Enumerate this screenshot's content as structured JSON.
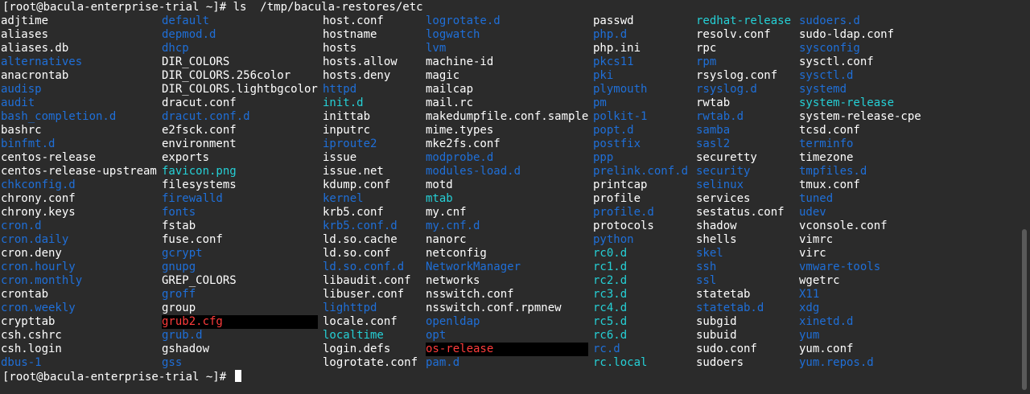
{
  "terminal": {
    "command_line": "[root@bacula-enterprise-trial ~]# ls  /tmp/bacula-restores/etc",
    "prompt": "[root@bacula-enterprise-trial ~]# ",
    "colors": {
      "background": "#2b2b2b",
      "file": "#ffffff",
      "dir": "#1f6fd8",
      "link": "#25d0d6",
      "broken": "#ff3b3b"
    },
    "columns": [
      [
        {
          "name": "adjtime",
          "kind": "file"
        },
        {
          "name": "aliases",
          "kind": "file"
        },
        {
          "name": "aliases.db",
          "kind": "file"
        },
        {
          "name": "alternatives",
          "kind": "dir"
        },
        {
          "name": "anacrontab",
          "kind": "file"
        },
        {
          "name": "audisp",
          "kind": "dir"
        },
        {
          "name": "audit",
          "kind": "dir"
        },
        {
          "name": "bash_completion.d",
          "kind": "dir"
        },
        {
          "name": "bashrc",
          "kind": "file"
        },
        {
          "name": "binfmt.d",
          "kind": "dir"
        },
        {
          "name": "centos-release",
          "kind": "file"
        },
        {
          "name": "centos-release-upstream",
          "kind": "file"
        },
        {
          "name": "chkconfig.d",
          "kind": "dir"
        },
        {
          "name": "chrony.conf",
          "kind": "file"
        },
        {
          "name": "chrony.keys",
          "kind": "file"
        },
        {
          "name": "cron.d",
          "kind": "dir"
        },
        {
          "name": "cron.daily",
          "kind": "dir"
        },
        {
          "name": "cron.deny",
          "kind": "file"
        },
        {
          "name": "cron.hourly",
          "kind": "dir"
        },
        {
          "name": "cron.monthly",
          "kind": "dir"
        },
        {
          "name": "crontab",
          "kind": "file"
        },
        {
          "name": "cron.weekly",
          "kind": "dir"
        },
        {
          "name": "crypttab",
          "kind": "file"
        },
        {
          "name": "csh.cshrc",
          "kind": "file"
        },
        {
          "name": "csh.login",
          "kind": "file"
        },
        {
          "name": "dbus-1",
          "kind": "dir"
        }
      ],
      [
        {
          "name": "default",
          "kind": "dir"
        },
        {
          "name": "depmod.d",
          "kind": "dir"
        },
        {
          "name": "dhcp",
          "kind": "dir"
        },
        {
          "name": "DIR_COLORS",
          "kind": "file"
        },
        {
          "name": "DIR_COLORS.256color",
          "kind": "file"
        },
        {
          "name": "DIR_COLORS.lightbgcolor",
          "kind": "file"
        },
        {
          "name": "dracut.conf",
          "kind": "file"
        },
        {
          "name": "dracut.conf.d",
          "kind": "dir"
        },
        {
          "name": "e2fsck.conf",
          "kind": "file"
        },
        {
          "name": "environment",
          "kind": "file"
        },
        {
          "name": "exports",
          "kind": "file"
        },
        {
          "name": "favicon.png",
          "kind": "link"
        },
        {
          "name": "filesystems",
          "kind": "file"
        },
        {
          "name": "firewalld",
          "kind": "dir"
        },
        {
          "name": "fonts",
          "kind": "dir"
        },
        {
          "name": "fstab",
          "kind": "file"
        },
        {
          "name": "fuse.conf",
          "kind": "file"
        },
        {
          "name": "gcrypt",
          "kind": "dir"
        },
        {
          "name": "gnupg",
          "kind": "dir"
        },
        {
          "name": "GREP_COLORS",
          "kind": "file"
        },
        {
          "name": "groff",
          "kind": "dir"
        },
        {
          "name": "group",
          "kind": "file"
        },
        {
          "name": "grub2.cfg",
          "kind": "broken"
        },
        {
          "name": "grub.d",
          "kind": "dir"
        },
        {
          "name": "gshadow",
          "kind": "file"
        },
        {
          "name": "gss",
          "kind": "dir"
        }
      ],
      [
        {
          "name": "host.conf",
          "kind": "file"
        },
        {
          "name": "hostname",
          "kind": "file"
        },
        {
          "name": "hosts",
          "kind": "file"
        },
        {
          "name": "hosts.allow",
          "kind": "file"
        },
        {
          "name": "hosts.deny",
          "kind": "file"
        },
        {
          "name": "httpd",
          "kind": "dir"
        },
        {
          "name": "init.d",
          "kind": "link"
        },
        {
          "name": "inittab",
          "kind": "file"
        },
        {
          "name": "inputrc",
          "kind": "file"
        },
        {
          "name": "iproute2",
          "kind": "dir"
        },
        {
          "name": "issue",
          "kind": "file"
        },
        {
          "name": "issue.net",
          "kind": "file"
        },
        {
          "name": "kdump.conf",
          "kind": "file"
        },
        {
          "name": "kernel",
          "kind": "dir"
        },
        {
          "name": "krb5.conf",
          "kind": "file"
        },
        {
          "name": "krb5.conf.d",
          "kind": "dir"
        },
        {
          "name": "ld.so.cache",
          "kind": "file"
        },
        {
          "name": "ld.so.conf",
          "kind": "file"
        },
        {
          "name": "ld.so.conf.d",
          "kind": "dir"
        },
        {
          "name": "libaudit.conf",
          "kind": "file"
        },
        {
          "name": "libuser.conf",
          "kind": "file"
        },
        {
          "name": "lighttpd",
          "kind": "dir"
        },
        {
          "name": "locale.conf",
          "kind": "file"
        },
        {
          "name": "localtime",
          "kind": "link"
        },
        {
          "name": "login.defs",
          "kind": "file"
        },
        {
          "name": "logrotate.conf",
          "kind": "file"
        }
      ],
      [
        {
          "name": "logrotate.d",
          "kind": "dir"
        },
        {
          "name": "logwatch",
          "kind": "dir"
        },
        {
          "name": "lvm",
          "kind": "dir"
        },
        {
          "name": "machine-id",
          "kind": "file"
        },
        {
          "name": "magic",
          "kind": "file"
        },
        {
          "name": "mailcap",
          "kind": "file"
        },
        {
          "name": "mail.rc",
          "kind": "file"
        },
        {
          "name": "makedumpfile.conf.sample",
          "kind": "file"
        },
        {
          "name": "mime.types",
          "kind": "file"
        },
        {
          "name": "mke2fs.conf",
          "kind": "file"
        },
        {
          "name": "modprobe.d",
          "kind": "dir"
        },
        {
          "name": "modules-load.d",
          "kind": "dir"
        },
        {
          "name": "motd",
          "kind": "file"
        },
        {
          "name": "mtab",
          "kind": "link"
        },
        {
          "name": "my.cnf",
          "kind": "file"
        },
        {
          "name": "my.cnf.d",
          "kind": "dir"
        },
        {
          "name": "nanorc",
          "kind": "file"
        },
        {
          "name": "netconfig",
          "kind": "file"
        },
        {
          "name": "NetworkManager",
          "kind": "dir"
        },
        {
          "name": "networks",
          "kind": "file"
        },
        {
          "name": "nsswitch.conf",
          "kind": "file"
        },
        {
          "name": "nsswitch.conf.rpmnew",
          "kind": "file"
        },
        {
          "name": "openldap",
          "kind": "dir"
        },
        {
          "name": "opt",
          "kind": "dir"
        },
        {
          "name": "os-release",
          "kind": "broken"
        },
        {
          "name": "pam.d",
          "kind": "dir"
        }
      ],
      [
        {
          "name": "passwd",
          "kind": "file"
        },
        {
          "name": "php.d",
          "kind": "dir"
        },
        {
          "name": "php.ini",
          "kind": "file"
        },
        {
          "name": "pkcs11",
          "kind": "dir"
        },
        {
          "name": "pki",
          "kind": "dir"
        },
        {
          "name": "plymouth",
          "kind": "dir"
        },
        {
          "name": "pm",
          "kind": "dir"
        },
        {
          "name": "polkit-1",
          "kind": "dir"
        },
        {
          "name": "popt.d",
          "kind": "dir"
        },
        {
          "name": "postfix",
          "kind": "dir"
        },
        {
          "name": "ppp",
          "kind": "dir"
        },
        {
          "name": "prelink.conf.d",
          "kind": "dir"
        },
        {
          "name": "printcap",
          "kind": "file"
        },
        {
          "name": "profile",
          "kind": "file"
        },
        {
          "name": "profile.d",
          "kind": "dir"
        },
        {
          "name": "protocols",
          "kind": "file"
        },
        {
          "name": "python",
          "kind": "dir"
        },
        {
          "name": "rc0.d",
          "kind": "link"
        },
        {
          "name": "rc1.d",
          "kind": "link"
        },
        {
          "name": "rc2.d",
          "kind": "link"
        },
        {
          "name": "rc3.d",
          "kind": "link"
        },
        {
          "name": "rc4.d",
          "kind": "link"
        },
        {
          "name": "rc5.d",
          "kind": "link"
        },
        {
          "name": "rc6.d",
          "kind": "link"
        },
        {
          "name": "rc.d",
          "kind": "dir"
        },
        {
          "name": "rc.local",
          "kind": "link"
        }
      ],
      [
        {
          "name": "redhat-release",
          "kind": "link"
        },
        {
          "name": "resolv.conf",
          "kind": "file"
        },
        {
          "name": "rpc",
          "kind": "file"
        },
        {
          "name": "rpm",
          "kind": "dir"
        },
        {
          "name": "rsyslog.conf",
          "kind": "file"
        },
        {
          "name": "rsyslog.d",
          "kind": "dir"
        },
        {
          "name": "rwtab",
          "kind": "file"
        },
        {
          "name": "rwtab.d",
          "kind": "dir"
        },
        {
          "name": "samba",
          "kind": "dir"
        },
        {
          "name": "sasl2",
          "kind": "dir"
        },
        {
          "name": "securetty",
          "kind": "file"
        },
        {
          "name": "security",
          "kind": "dir"
        },
        {
          "name": "selinux",
          "kind": "dir"
        },
        {
          "name": "services",
          "kind": "file"
        },
        {
          "name": "sestatus.conf",
          "kind": "file"
        },
        {
          "name": "shadow",
          "kind": "file"
        },
        {
          "name": "shells",
          "kind": "file"
        },
        {
          "name": "skel",
          "kind": "dir"
        },
        {
          "name": "ssh",
          "kind": "dir"
        },
        {
          "name": "ssl",
          "kind": "dir"
        },
        {
          "name": "statetab",
          "kind": "file"
        },
        {
          "name": "statetab.d",
          "kind": "dir"
        },
        {
          "name": "subgid",
          "kind": "file"
        },
        {
          "name": "subuid",
          "kind": "file"
        },
        {
          "name": "sudo.conf",
          "kind": "file"
        },
        {
          "name": "sudoers",
          "kind": "file"
        }
      ],
      [
        {
          "name": "sudoers.d",
          "kind": "dir"
        },
        {
          "name": "sudo-ldap.conf",
          "kind": "file"
        },
        {
          "name": "sysconfig",
          "kind": "dir"
        },
        {
          "name": "sysctl.conf",
          "kind": "file"
        },
        {
          "name": "sysctl.d",
          "kind": "dir"
        },
        {
          "name": "systemd",
          "kind": "dir"
        },
        {
          "name": "system-release",
          "kind": "link"
        },
        {
          "name": "system-release-cpe",
          "kind": "file"
        },
        {
          "name": "tcsd.conf",
          "kind": "file"
        },
        {
          "name": "terminfo",
          "kind": "dir"
        },
        {
          "name": "timezone",
          "kind": "file"
        },
        {
          "name": "tmpfiles.d",
          "kind": "dir"
        },
        {
          "name": "tmux.conf",
          "kind": "file"
        },
        {
          "name": "tuned",
          "kind": "dir"
        },
        {
          "name": "udev",
          "kind": "dir"
        },
        {
          "name": "vconsole.conf",
          "kind": "file"
        },
        {
          "name": "vimrc",
          "kind": "file"
        },
        {
          "name": "virc",
          "kind": "file"
        },
        {
          "name": "vmware-tools",
          "kind": "dir"
        },
        {
          "name": "wgetrc",
          "kind": "file"
        },
        {
          "name": "X11",
          "kind": "dir"
        },
        {
          "name": "xdg",
          "kind": "dir"
        },
        {
          "name": "xinetd.d",
          "kind": "dir"
        },
        {
          "name": "yum",
          "kind": "dir"
        },
        {
          "name": "yum.conf",
          "kind": "file"
        },
        {
          "name": "yum.repos.d",
          "kind": "dir"
        }
      ]
    ]
  }
}
